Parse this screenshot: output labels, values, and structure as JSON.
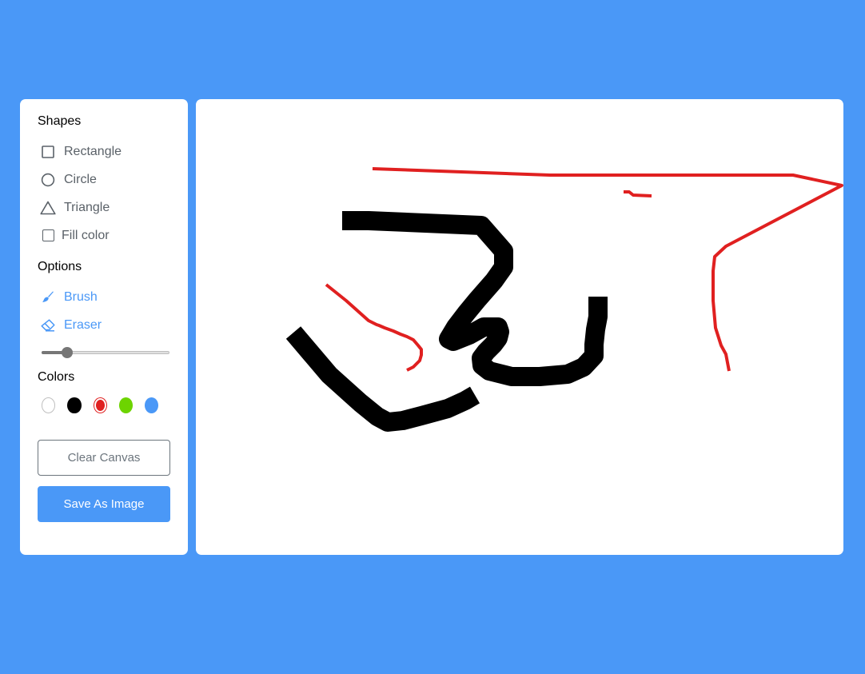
{
  "tools": {
    "shapes_title": "Shapes",
    "shapes": [
      {
        "label": "Rectangle",
        "icon": "square-icon"
      },
      {
        "label": "Circle",
        "icon": "circle-icon"
      },
      {
        "label": "Triangle",
        "icon": "triangle-icon"
      }
    ],
    "fill_color_label": "Fill color",
    "fill_color_checked": false,
    "options_title": "Options",
    "options": [
      {
        "label": "Brush",
        "icon": "brush-icon",
        "active": true
      },
      {
        "label": "Eraser",
        "icon": "eraser-icon",
        "active": false
      }
    ],
    "brush_size_fraction": 0.2,
    "colors_title": "Colors",
    "colors": [
      {
        "name": "white",
        "hex": "#ffffff",
        "selected": false
      },
      {
        "name": "black",
        "hex": "#000000",
        "selected": false
      },
      {
        "name": "red",
        "hex": "#e02020",
        "selected": true
      },
      {
        "name": "green",
        "hex": "#6dd400",
        "selected": false
      },
      {
        "name": "blue",
        "hex": "#4a98f7",
        "selected": false
      }
    ],
    "clear_label": "Clear Canvas",
    "save_label": "Save As Image"
  },
  "theme": {
    "accent": "#4a98f7",
    "text_muted": "#5a6168"
  }
}
